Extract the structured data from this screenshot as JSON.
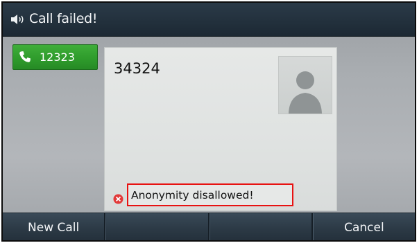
{
  "title_bar": {
    "icon": "speaker-icon",
    "title": "Call failed!"
  },
  "line_key": {
    "icon": "phone-handset-icon",
    "label": "12323",
    "color": "#2f9c2c"
  },
  "call": {
    "number": "34324",
    "avatar_icon": "contact-avatar-icon",
    "status_icon": "error-x-icon",
    "status_text": "Anonymity disallowed!",
    "status_highlight_color": "#e81212"
  },
  "softkeys": [
    {
      "label": "New Call"
    },
    {
      "label": ""
    },
    {
      "label": ""
    },
    {
      "label": "Cancel"
    }
  ]
}
